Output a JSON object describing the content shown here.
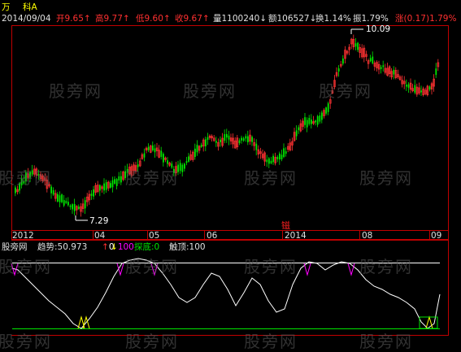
{
  "header": {
    "title_left": "万",
    "title_right": "科A",
    "date": "2014/09/04",
    "open": {
      "label": "开",
      "value": "9.65"
    },
    "high": {
      "label": "高",
      "value": "9.77"
    },
    "low": {
      "label": "低",
      "value": "9.60"
    },
    "close": {
      "label": "收",
      "value": "9.67"
    },
    "volume": {
      "label": "量",
      "value": "1100240"
    },
    "amount": {
      "label": "额",
      "value": "106527"
    },
    "turnover": {
      "label": "换",
      "value": "1.14%"
    },
    "amplitude": {
      "label": "振",
      "value": "1.79%"
    },
    "change": {
      "label": "涨",
      "value": "(0.17)",
      "pct": "1.79%"
    }
  },
  "annotations": {
    "high_label": "10.09",
    "low_label": "7.29"
  },
  "xaxis": {
    "labels": [
      "2012",
      "04",
      "05",
      "06",
      "2014",
      "08",
      "09"
    ]
  },
  "indicator": {
    "name": "股旁网",
    "trend_label": "趋势:",
    "trend_value": "50.973",
    "up_value": "0",
    "down_value": "100",
    "bottom_label": "探底:",
    "bottom_value": "0",
    "top_label": "触顶:",
    "top_value": "100"
  },
  "watermark": "股旁网",
  "colors": {
    "up": "#ff3232",
    "down": "#00e600",
    "axis": "#c00000",
    "white": "#ffffff",
    "yellow": "#ffff00",
    "magenta": "#ff00ff",
    "cyan": "#00ffff"
  }
}
